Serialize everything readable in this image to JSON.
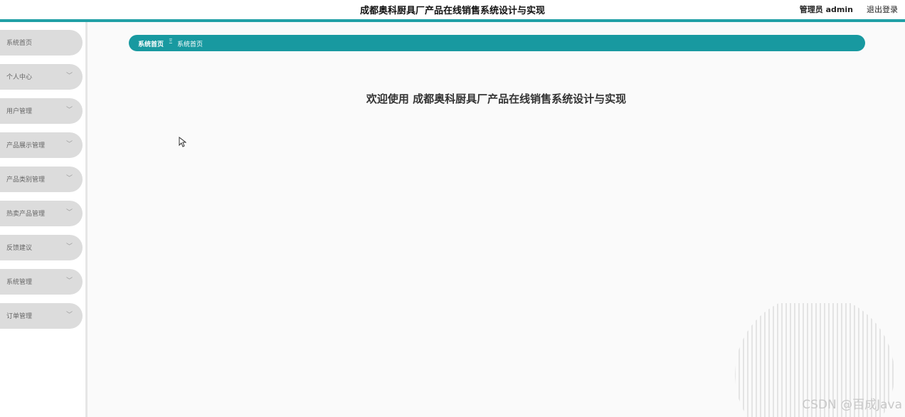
{
  "header": {
    "title": "成都奥科厨具厂产品在线销售系统设计与实现",
    "user": "管理员 admin",
    "logout": "退出登录"
  },
  "sidebar": {
    "items": [
      {
        "label": "系统首页",
        "expandable": false
      },
      {
        "label": "个人中心",
        "expandable": true
      },
      {
        "label": "用户管理",
        "expandable": true
      },
      {
        "label": "产品展示管理",
        "expandable": true
      },
      {
        "label": "产品类别管理",
        "expandable": true
      },
      {
        "label": "热卖产品管理",
        "expandable": true
      },
      {
        "label": "反馈建议",
        "expandable": true
      },
      {
        "label": "系统管理",
        "expandable": true
      },
      {
        "label": "订单管理",
        "expandable": true
      }
    ]
  },
  "breadcrumb": {
    "home": "系统首页",
    "separator": "Ξ",
    "current": "系统首页"
  },
  "main": {
    "welcome": "欢迎使用 成都奥科厨具厂产品在线销售系统设计与实现"
  },
  "watermark": "CSDN @百成Java",
  "colors": {
    "accent": "#1899a0",
    "menu_bg": "#dcdcdc"
  }
}
